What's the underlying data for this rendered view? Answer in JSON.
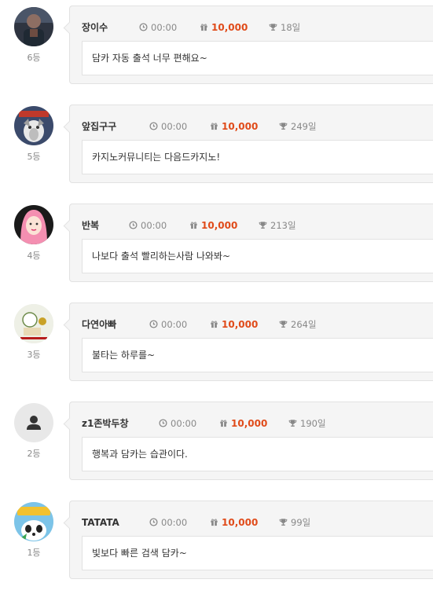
{
  "entries": [
    {
      "name": "장이수",
      "time": "00:00",
      "points": "10,000",
      "days": "18일",
      "message": "담카 자동 출석 너무 편해요~",
      "rank": "6등",
      "avatar": "photo-avatar-man"
    },
    {
      "name": "앞집구구",
      "time": "00:00",
      "points": "10,000",
      "days": "249일",
      "message": "카지노커뮤니티는 다음드카지노!",
      "rank": "5등",
      "avatar": "cartoon-dog-avatar"
    },
    {
      "name": "반복",
      "time": "00:00",
      "points": "10,000",
      "days": "213일",
      "message": "나보다 출석 빨리하는사람 나와봐~",
      "rank": "4등",
      "avatar": "photo-avatar-woman"
    },
    {
      "name": "다연아빠",
      "time": "00:00",
      "points": "10,000",
      "days": "264일",
      "message": "불타는 하루를~",
      "rank": "3등",
      "avatar": "illustration-avatar"
    },
    {
      "name": "z1존박두창",
      "time": "00:00",
      "points": "10,000",
      "days": "190일",
      "message": "행복과 담카는 습관이다.",
      "rank": "2등",
      "avatar": "default-user-avatar"
    },
    {
      "name": "TATATA",
      "time": "00:00",
      "points": "10,000",
      "days": "99일",
      "message": "빛보다 빠른 검색 담카~",
      "rank": "1등",
      "avatar": "panda-avatar"
    }
  ],
  "icons": {
    "time": "clock-icon",
    "points": "gift-icon",
    "days": "trophy-icon"
  },
  "colors": {
    "points": "#e04b1a",
    "bubble": "#f5f5f5",
    "border": "#e2e2e2"
  }
}
